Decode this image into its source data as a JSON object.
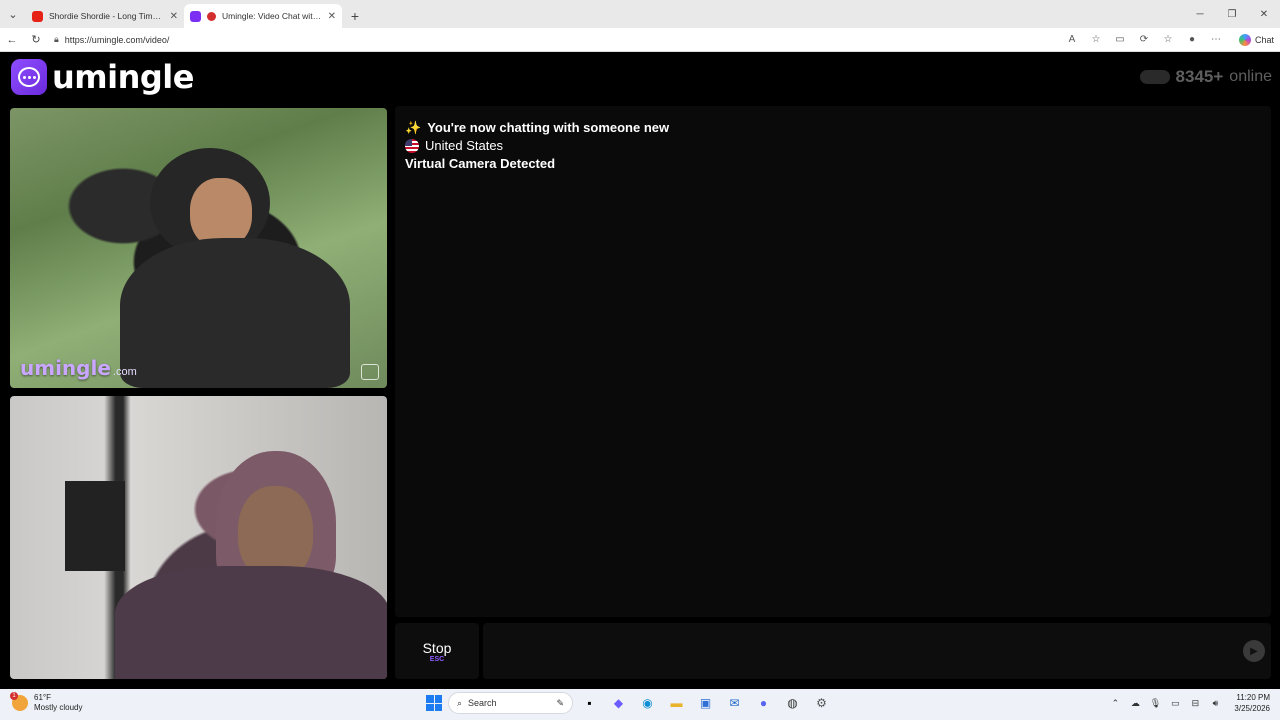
{
  "browser": {
    "tabs": [
      {
        "title": "Shordie Shordie - Long Time (Offi",
        "favicon_color": "#e62117",
        "active": false
      },
      {
        "title": "Umingle: Video Chat with Stra",
        "favicon_color": "#7b2ff2",
        "active": true
      }
    ],
    "new_tab": "+",
    "url": "https://umingle.com/video/",
    "copilot_label": "Chat"
  },
  "site": {
    "logo_text": "umingle",
    "online_count": "8345+",
    "online_label": "online",
    "accent_color": "#7b2ff2"
  },
  "remote_video": {
    "watermark_main": "umingle",
    "watermark_sub": ".com"
  },
  "chat": {
    "messages": [
      {
        "icon": "sparkle",
        "text": "You're now chatting with someone new"
      },
      {
        "icon": "us-flag",
        "text": "United States"
      },
      {
        "icon": "",
        "text": "Virtual Camera Detected"
      }
    ]
  },
  "controls": {
    "stop_label": "Stop",
    "stop_key": "ESC",
    "input_value": "",
    "input_placeholder": ""
  },
  "taskbar": {
    "weather_temp": "61°F",
    "weather_desc": "Mostly cloudy",
    "weather_alert": "1",
    "search_placeholder": "Search",
    "time": "11:20 PM",
    "date": "3/25/2026"
  }
}
